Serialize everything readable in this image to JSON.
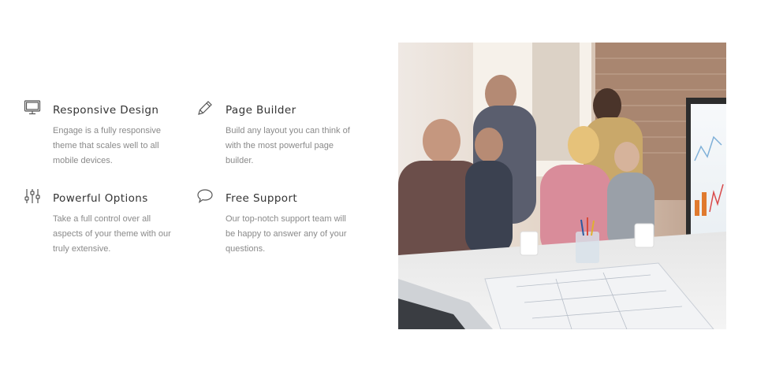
{
  "features": [
    {
      "icon": "monitor-icon",
      "title": "Responsive Design",
      "text": "Engage is a fully responsive theme that scales well to all mobile devices."
    },
    {
      "icon": "pencil-icon",
      "title": "Page Builder",
      "text": "Build any layout you can think of with the most powerful page builder."
    },
    {
      "icon": "sliders-icon",
      "title": "Powerful Options",
      "text": "Take a full control over all aspects of your theme with our truly extensive."
    },
    {
      "icon": "speech-bubble-icon",
      "title": "Free Support",
      "text": "Our top-notch support team will be happy to answer any of your questions."
    }
  ],
  "colors": {
    "heading": "#333333",
    "body_text": "#8a8a8a",
    "icon": "#555555"
  }
}
